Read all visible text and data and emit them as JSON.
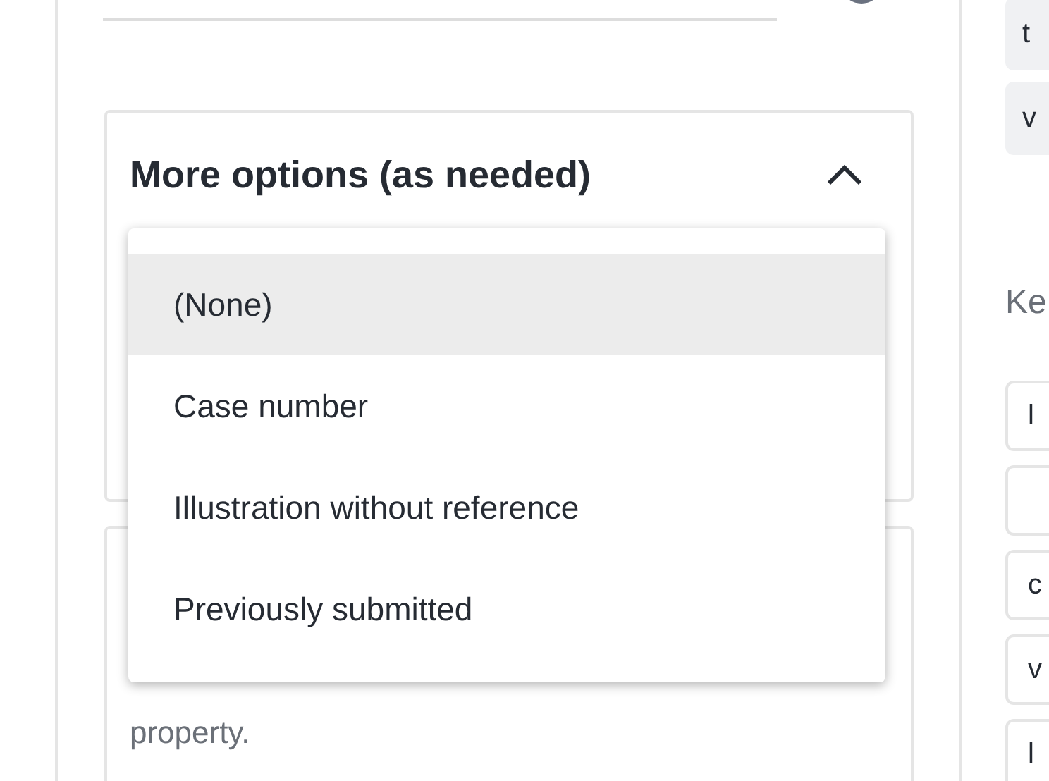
{
  "section": {
    "title": "More options (as needed)",
    "expanded": true
  },
  "dropdown": {
    "options": [
      {
        "label": "(None)",
        "selected": true
      },
      {
        "label": "Case number",
        "selected": false
      },
      {
        "label": "Illustration without reference",
        "selected": false
      },
      {
        "label": "Previously submitted",
        "selected": false
      }
    ]
  },
  "note": {
    "text": "property."
  },
  "side": {
    "chips": [
      "t",
      "v"
    ],
    "heading": "Ke",
    "keys": [
      {
        "kind": "text",
        "label": "l"
      },
      {
        "kind": "blank"
      },
      {
        "kind": "text",
        "label": "c"
      },
      {
        "kind": "text",
        "label": "v"
      },
      {
        "kind": "text",
        "label": "l"
      }
    ]
  }
}
